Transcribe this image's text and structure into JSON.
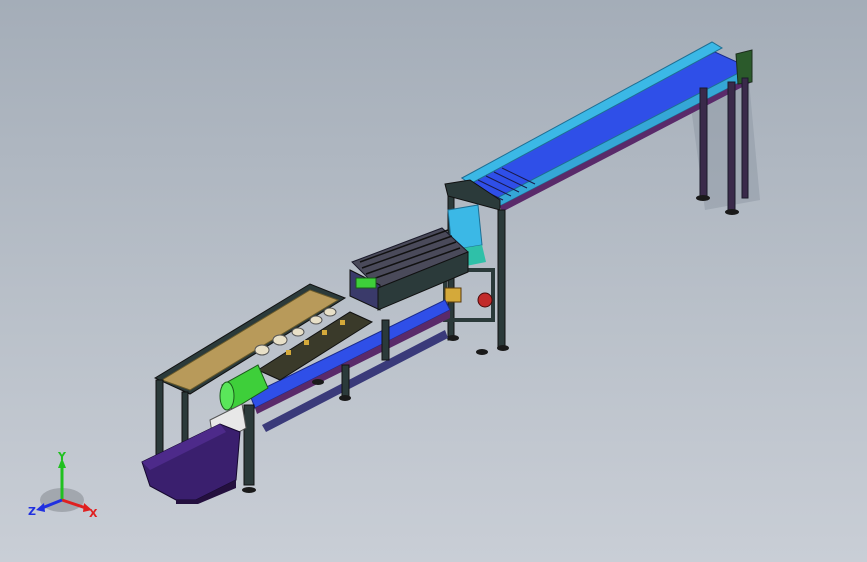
{
  "viewport": {
    "background": "#b4bcc6"
  },
  "colors": {
    "frame_dark": "#2b3a3a",
    "frame_purple": "#5a2a6a",
    "conveyor_blue": "#2f4fe8",
    "conveyor_cyan": "#3bb8e6",
    "tray_tan": "#b89a5a",
    "hopper_purple": "#3a1f6e",
    "roller_green": "#3ecf3a",
    "accent_red": "#c22a2a"
  },
  "triad": {
    "x_label": "X",
    "y_label": "Y",
    "z_label": "Z",
    "x_color": "#e02020",
    "y_color": "#20c020",
    "z_color": "#2030e0"
  }
}
